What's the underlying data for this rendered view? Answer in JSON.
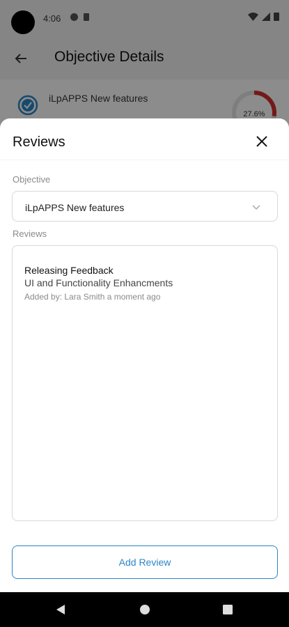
{
  "status_bar": {
    "time": "4:06"
  },
  "background": {
    "app_title": "Objective Details",
    "objective_title": "iLpAPPS New features",
    "progress_text": "27.6%",
    "progress_fraction": 0.276
  },
  "sheet": {
    "title": "Reviews",
    "objective_label": "Objective",
    "objective_value": "iLpAPPS New features",
    "reviews_label": "Reviews",
    "reviews": [
      {
        "title": "Releasing Feedback",
        "description": "UI and Functionality Enhancments",
        "meta": "Added by: Lara Smith a moment ago"
      }
    ],
    "add_button_label": "Add Review"
  },
  "colors": {
    "accent": "#2a86c6",
    "progress_ring": "#d32f2f"
  }
}
